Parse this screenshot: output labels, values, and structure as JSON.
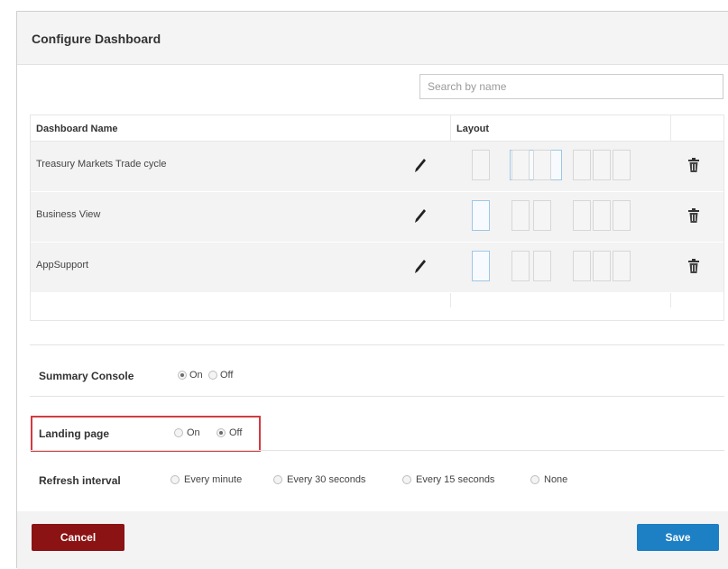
{
  "dialog": {
    "title": "Configure Dashboard"
  },
  "search": {
    "placeholder": "Search by name",
    "value": ""
  },
  "table": {
    "headers": {
      "name": "Dashboard Name",
      "layout": "Layout"
    },
    "rows": [
      {
        "name": "Treasury Markets Trade cycle",
        "selected_layout": "two-column"
      },
      {
        "name": "Business View",
        "selected_layout": "one-column"
      },
      {
        "name": "AppSupport",
        "selected_layout": "one-column"
      }
    ],
    "icons": {
      "edit": "pencil-icon",
      "delete": "trash-icon"
    }
  },
  "settings": {
    "summary_console": {
      "label": "Summary Console",
      "options": [
        "On",
        "Off"
      ],
      "selected": "On"
    },
    "landing_page": {
      "label": "Landing page",
      "options": [
        "On",
        "Off"
      ],
      "selected": "Off"
    },
    "refresh_interval": {
      "label": "Refresh interval",
      "options": [
        "Every minute",
        "Every 30 seconds",
        "Every 15 seconds",
        "None"
      ],
      "selected": ""
    }
  },
  "footer": {
    "cancel_label": "Cancel",
    "save_label": "Save"
  },
  "colors": {
    "highlight": "#d23a40",
    "cancel": "#8b1313",
    "save": "#1d7fc4",
    "header_bg": "#f4f4f4"
  }
}
